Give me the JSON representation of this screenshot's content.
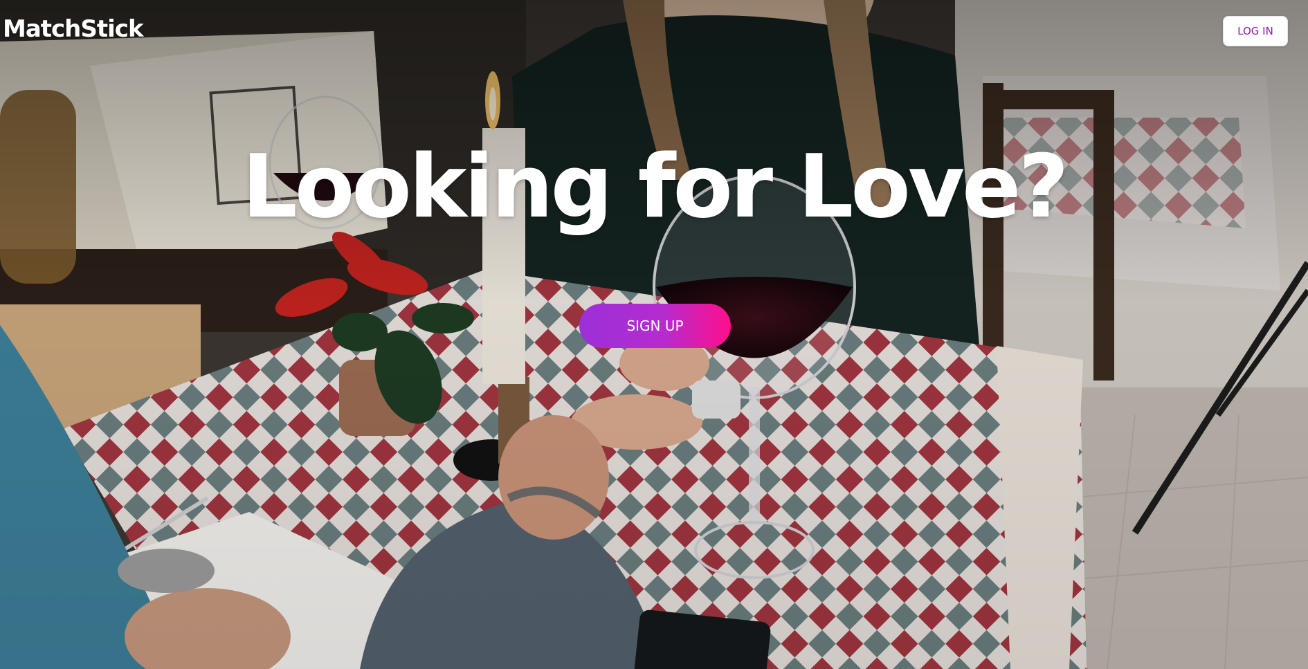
{
  "header": {
    "brand": "MatchStick",
    "login_label": "LOG IN"
  },
  "hero": {
    "headline": "Looking for Love?",
    "signup_label": "SIGN UP"
  },
  "colors": {
    "login_text": "#8a1ca6",
    "signup_gradient_start": "#9b30d9",
    "signup_gradient_end": "#ff0f8a"
  }
}
